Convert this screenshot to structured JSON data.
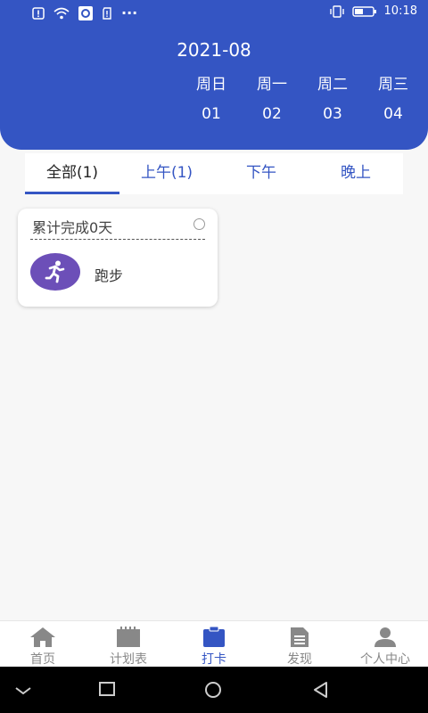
{
  "status_bar": {
    "time": "10:18",
    "left_icons": [
      "alert-icon",
      "wifi-icon",
      "qq-icon",
      "sim-alert-icon",
      "more-dots-icon"
    ],
    "right_icons": [
      "vibrate-icon",
      "battery-icon"
    ],
    "more": "···"
  },
  "header": {
    "month": "2021-08",
    "weekdays": [
      "周日",
      "周一",
      "周二",
      "周三"
    ],
    "dates": [
      "01",
      "02",
      "03",
      "04"
    ]
  },
  "tabs": [
    {
      "label": "全部(1)",
      "active": true
    },
    {
      "label": "上午(1)",
      "active": false
    },
    {
      "label": "下午",
      "active": false
    },
    {
      "label": "晚上",
      "active": false
    }
  ],
  "card": {
    "title": "累计完成0天",
    "task_label": "跑步",
    "task_icon": "running-person-icon"
  },
  "bottom_nav": [
    {
      "label": "首页",
      "icon": "home-icon",
      "active": false
    },
    {
      "label": "计划表",
      "icon": "calendar-icon",
      "active": false
    },
    {
      "label": "打卡",
      "icon": "clipboard-icon",
      "active": true
    },
    {
      "label": "发现",
      "icon": "document-icon",
      "active": false
    },
    {
      "label": "个人中心",
      "icon": "user-icon",
      "active": false
    }
  ],
  "colors": {
    "primary": "#3455c3",
    "task_icon_bg": "#6c4fb8",
    "inactive": "#888888"
  }
}
